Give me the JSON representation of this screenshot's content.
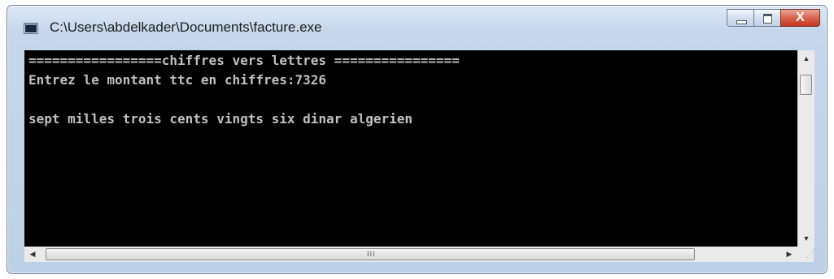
{
  "window": {
    "title": "C:\\Users\\abdelkader\\Documents\\facture.exe",
    "close_glyph": "X"
  },
  "console": {
    "lines": [
      "=================chiffres vers lettres ================",
      "Entrez le montant ttc en chiffres:7326",
      "",
      "sept milles trois cents vingts six dinar algerien"
    ],
    "background": "#000000",
    "foreground": "#c0c0c0"
  },
  "scrollbars": {
    "vertical_thumb_position": 0.0,
    "horizontal_thumb_grip": "III"
  },
  "icons": {
    "app": "console-app-icon",
    "minimize": "minimize-icon",
    "maximize": "maximize-icon",
    "close": "close-icon",
    "scroll_up": "arrow-up-icon",
    "scroll_down": "arrow-down-icon",
    "scroll_left": "arrow-left-icon",
    "scroll_right": "arrow-right-icon"
  }
}
